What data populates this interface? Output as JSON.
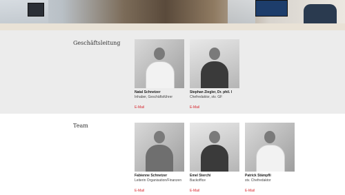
{
  "colors": {
    "accent": "#d6282f",
    "lead_section_bg": "#ececec",
    "team_section_bg": "#ffffff"
  },
  "hero": {
    "image": "office-photo"
  },
  "leadership": {
    "title": "Geschäftsleitung",
    "members": [
      {
        "name": "Natal Schnetzer",
        "role": "Inhaber, Geschäftsführer",
        "email_label": "E-Mail"
      },
      {
        "name": "Stephan Ziegler, Dr. phil. I",
        "role": "Chefredaktor, stv. GF",
        "email_label": "E-Mail"
      }
    ]
  },
  "team": {
    "title": "Team",
    "members": [
      {
        "name": "Fabienne Schnetzer",
        "role": "Leiterin Organisation/Finanzen",
        "email_label": "E-Mail"
      },
      {
        "name": "Emel Sterchi",
        "role": "Backoffice",
        "email_label": "E-Mail"
      },
      {
        "name": "Patrick Stämpfli",
        "role": "stv. Chefredaktor",
        "email_label": "E-Mail"
      }
    ]
  }
}
